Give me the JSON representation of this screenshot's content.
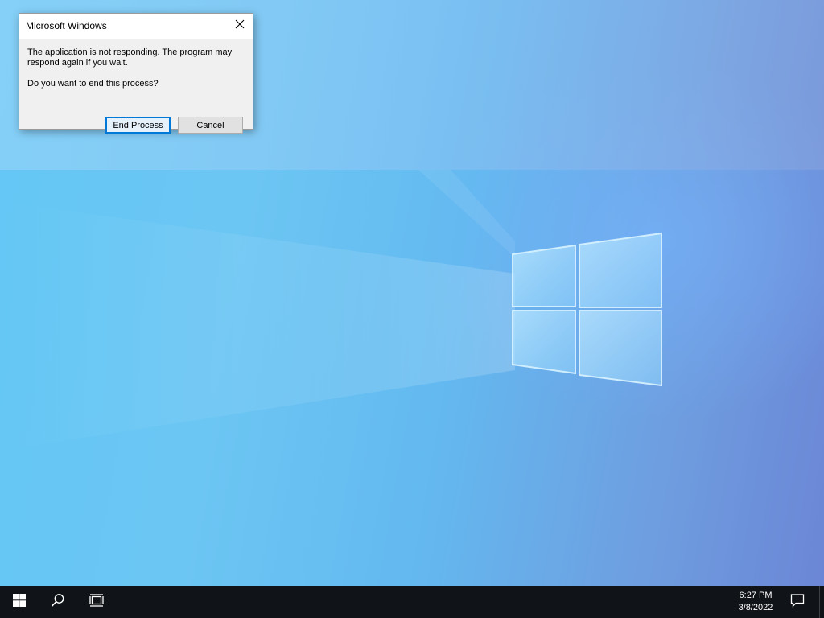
{
  "desktop": {
    "background": "windows-10-light-wallpaper"
  },
  "dialog": {
    "title": "Microsoft Windows",
    "message": "The application is not responding. The program may respond again if you wait.",
    "question": "Do you want to end this process?",
    "buttons": {
      "end_process": "End Process",
      "cancel": "Cancel"
    },
    "close_icon": "close-icon"
  },
  "taskbar": {
    "start_icon": "windows-start-icon",
    "search_icon": "search-icon",
    "task_view_icon": "task-view-icon",
    "clock": {
      "time": "6:27 PM",
      "date": "3/8/2022"
    },
    "notification_icon": "action-center-icon"
  },
  "colors": {
    "accent": "#0078d7",
    "taskbar": "#101418",
    "dialog_bg": "#f0f0f0"
  }
}
